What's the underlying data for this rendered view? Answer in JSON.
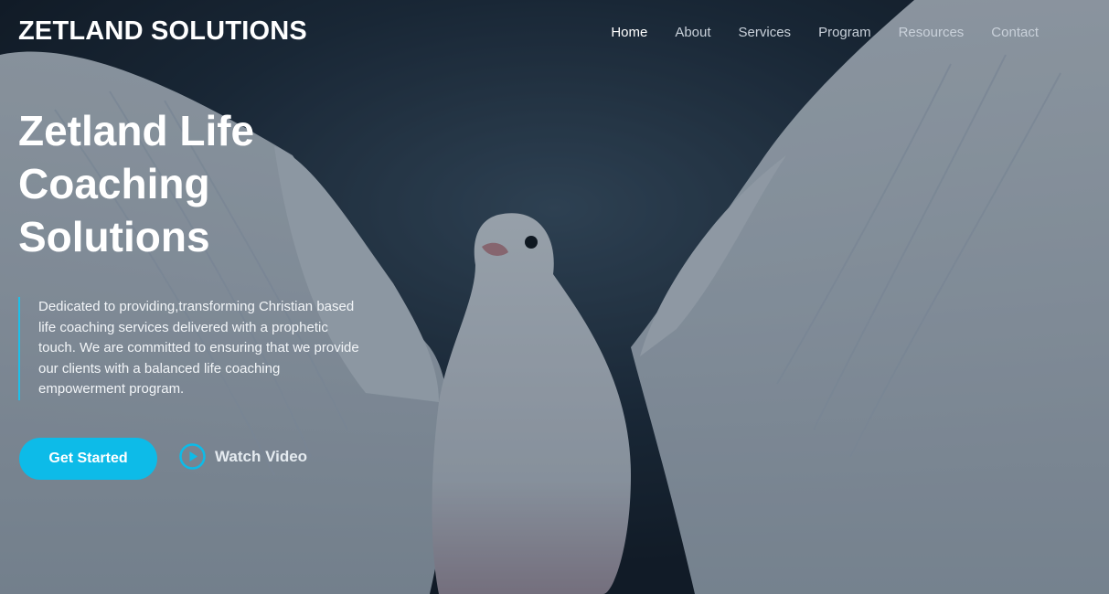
{
  "brand": {
    "name": "ZETLAND SOLUTIONS"
  },
  "nav": {
    "items": [
      {
        "label": "Home",
        "active": true
      },
      {
        "label": "About"
      },
      {
        "label": "Services"
      },
      {
        "label": "Program"
      },
      {
        "label": "Resources"
      },
      {
        "label": "Contact"
      }
    ]
  },
  "hero": {
    "headline": "Zetland Life Coaching Solutions",
    "description": "Dedicated to providing,transforming Christian based life coaching services delivered with a prophetic touch. We are committed to ensuring that we provide our clients with a balanced life coaching empowerment program.",
    "cta_primary": "Get Started",
    "cta_secondary": "Watch Video",
    "background_image": "white-dove-wings-spread"
  },
  "colors": {
    "accent": "#0dbbe8",
    "overlay": "#14202d",
    "text": "#ffffff"
  },
  "icons": {
    "play": "play-circle-icon"
  }
}
